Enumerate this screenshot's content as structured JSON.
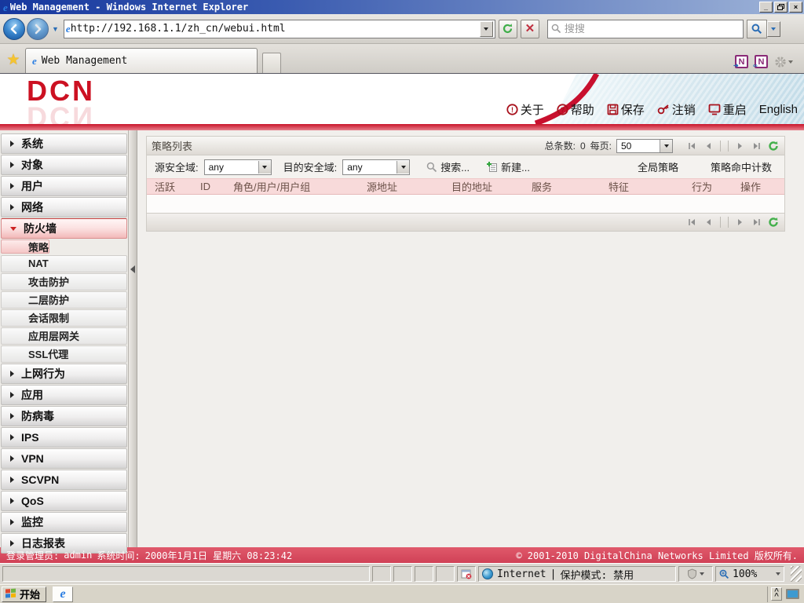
{
  "colors": {
    "accent_red": "#c8102e",
    "footer_red": "#d84a5e",
    "table_header_pink": "#f8dada",
    "selected_pink": "#f5c6c6",
    "refresh_green": "#44b04c"
  },
  "browser": {
    "title": "Web Management - Windows Internet Explorer",
    "url": "http://192.168.1.1/zh_cn/webui.html",
    "search_placeholder": "搜搜",
    "tab": "Web Management",
    "status_zone": "Internet",
    "status_protected": "保护模式: 禁用",
    "status_zoom": "100%"
  },
  "taskbar": {
    "start": "开始"
  },
  "page": {
    "brand": "DCN",
    "header_links": [
      {
        "label": "关于"
      },
      {
        "label": "帮助"
      },
      {
        "label": "保存"
      },
      {
        "label": "注销"
      },
      {
        "label": "重启"
      },
      {
        "label": "English"
      }
    ],
    "sidebar": {
      "top": [
        "系统",
        "对象",
        "用户",
        "网络",
        "防火墙",
        "上网行为",
        "应用",
        "防病毒",
        "IPS",
        "VPN",
        "SCVPN",
        "QoS",
        "监控",
        "日志报表"
      ],
      "firewall_children": [
        "策略",
        "NAT",
        "攻击防护",
        "二层防护",
        "会话限制",
        "应用层网关",
        "SSL代理"
      ],
      "selected_child": "策略"
    },
    "panel": {
      "title": "策略列表",
      "total_label": "总条数:",
      "total_value": "0",
      "per_page_label": "每页:",
      "per_page_value": "50",
      "src_zone_label": "源安全域:",
      "src_zone_value": "any",
      "dst_zone_label": "目的安全域:",
      "dst_zone_value": "any",
      "search_label": "搜索...",
      "new_label": "新建...",
      "global_policy_label": "全局策略",
      "hit_count_label": "策略命中计数",
      "columns": [
        "活跃",
        "ID",
        "角色/用户/用户组",
        "源地址",
        "目的地址",
        "服务",
        "特征",
        "行为",
        "操作"
      ],
      "rows": []
    },
    "footer": {
      "admin_label": "登录管理员:",
      "admin_value": "admin",
      "time_label": "系统时间:",
      "time_value": "2000年1月1日 星期六 08:23:42",
      "copyright": "© 2001-2010 DigitalChina Networks Limited 版权所有."
    }
  }
}
